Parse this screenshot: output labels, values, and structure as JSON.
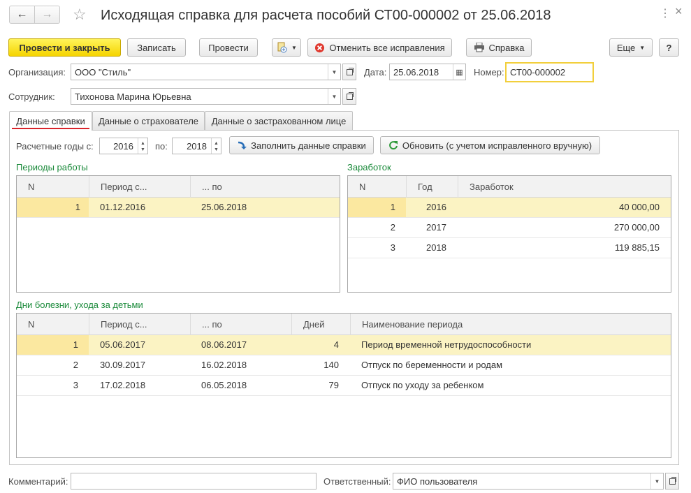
{
  "window": {
    "title": "Исходящая справка для расчета пособий СТ00-000002 от 25.06.2018",
    "close_label": "×",
    "back_glyph": "🡐",
    "forward_glyph": "🡒",
    "star_glyph": "☆",
    "more_glyph": "⋮"
  },
  "toolbar": {
    "post_close": "Провести и закрыть",
    "save": "Записать",
    "post": "Провести",
    "cancel_all": "Отменить все исправления",
    "certificate": "Справка",
    "more": "Еще",
    "help": "?"
  },
  "header": {
    "org_label": "Организация:",
    "org_value": "ООО \"Стиль\"",
    "date_label": "Дата:",
    "date_value": "25.06.2018",
    "number_label": "Номер:",
    "number_value": "СТ00-000002",
    "employee_label": "Сотрудник:",
    "employee_value": "Тихонова Марина Юрьевна"
  },
  "tabs": [
    {
      "label": "Данные справки"
    },
    {
      "label": "Данные о страхователе"
    },
    {
      "label": "Данные о застрахованном лице"
    }
  ],
  "years": {
    "label_from": "Расчетные годы с:",
    "from": "2016",
    "label_to": "по:",
    "to": "2018",
    "fill_button": "Заполнить данные справки",
    "refresh_button": "Обновить (с учетом исправленного вручную)"
  },
  "work_periods": {
    "title": "Периоды работы",
    "columns": [
      "N",
      "Период с...",
      "... по"
    ],
    "rows": [
      {
        "n": "1",
        "from": "01.12.2016",
        "to": "25.06.2018"
      }
    ]
  },
  "earnings": {
    "title": "Заработок",
    "columns": [
      "N",
      "Год",
      "Заработок"
    ],
    "rows": [
      {
        "n": "1",
        "year": "2016",
        "amount": "40 000,00"
      },
      {
        "n": "2",
        "year": "2017",
        "amount": "270 000,00"
      },
      {
        "n": "3",
        "year": "2018",
        "amount": "119 885,15"
      }
    ]
  },
  "sick_days": {
    "title": "Дни болезни, ухода за детьми",
    "columns": [
      "N",
      "Период с...",
      "... по",
      "Дней",
      "Наименование периода"
    ],
    "rows": [
      {
        "n": "1",
        "from": "05.06.2017",
        "to": "08.06.2017",
        "days": "4",
        "name": "Период временной нетрудоспособности"
      },
      {
        "n": "2",
        "from": "30.09.2017",
        "to": "16.02.2018",
        "days": "140",
        "name": "Отпуск по беременности и родам"
      },
      {
        "n": "3",
        "from": "17.02.2018",
        "to": "06.05.2018",
        "days": "79",
        "name": "Отпуск по уходу за ребенком"
      }
    ]
  },
  "footer": {
    "comment_label": "Комментарий:",
    "comment_value": "",
    "responsible_label": "Ответственный:",
    "responsible_value": "ФИО пользователя"
  },
  "colors": {
    "accent_yellow": "#f5d400",
    "group_title_green": "#1a8a3a",
    "selected_row": "#fbf3c3",
    "tab_underline": "#d9242b"
  }
}
